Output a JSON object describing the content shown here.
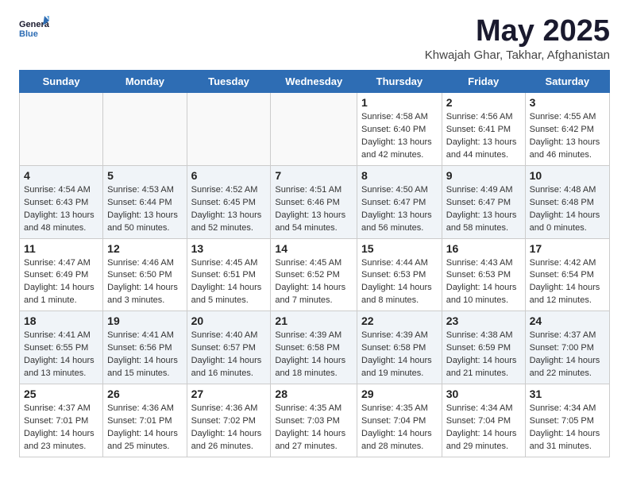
{
  "header": {
    "logo_general": "General",
    "logo_blue": "Blue",
    "month_year": "May 2025",
    "location": "Khwajah Ghar, Takhar, Afghanistan"
  },
  "days_of_week": [
    "Sunday",
    "Monday",
    "Tuesday",
    "Wednesday",
    "Thursday",
    "Friday",
    "Saturday"
  ],
  "weeks": [
    [
      {
        "day": "",
        "info": ""
      },
      {
        "day": "",
        "info": ""
      },
      {
        "day": "",
        "info": ""
      },
      {
        "day": "",
        "info": ""
      },
      {
        "day": "1",
        "info": "Sunrise: 4:58 AM\nSunset: 6:40 PM\nDaylight: 13 hours\nand 42 minutes."
      },
      {
        "day": "2",
        "info": "Sunrise: 4:56 AM\nSunset: 6:41 PM\nDaylight: 13 hours\nand 44 minutes."
      },
      {
        "day": "3",
        "info": "Sunrise: 4:55 AM\nSunset: 6:42 PM\nDaylight: 13 hours\nand 46 minutes."
      }
    ],
    [
      {
        "day": "4",
        "info": "Sunrise: 4:54 AM\nSunset: 6:43 PM\nDaylight: 13 hours\nand 48 minutes."
      },
      {
        "day": "5",
        "info": "Sunrise: 4:53 AM\nSunset: 6:44 PM\nDaylight: 13 hours\nand 50 minutes."
      },
      {
        "day": "6",
        "info": "Sunrise: 4:52 AM\nSunset: 6:45 PM\nDaylight: 13 hours\nand 52 minutes."
      },
      {
        "day": "7",
        "info": "Sunrise: 4:51 AM\nSunset: 6:46 PM\nDaylight: 13 hours\nand 54 minutes."
      },
      {
        "day": "8",
        "info": "Sunrise: 4:50 AM\nSunset: 6:47 PM\nDaylight: 13 hours\nand 56 minutes."
      },
      {
        "day": "9",
        "info": "Sunrise: 4:49 AM\nSunset: 6:47 PM\nDaylight: 13 hours\nand 58 minutes."
      },
      {
        "day": "10",
        "info": "Sunrise: 4:48 AM\nSunset: 6:48 PM\nDaylight: 14 hours\nand 0 minutes."
      }
    ],
    [
      {
        "day": "11",
        "info": "Sunrise: 4:47 AM\nSunset: 6:49 PM\nDaylight: 14 hours\nand 1 minute."
      },
      {
        "day": "12",
        "info": "Sunrise: 4:46 AM\nSunset: 6:50 PM\nDaylight: 14 hours\nand 3 minutes."
      },
      {
        "day": "13",
        "info": "Sunrise: 4:45 AM\nSunset: 6:51 PM\nDaylight: 14 hours\nand 5 minutes."
      },
      {
        "day": "14",
        "info": "Sunrise: 4:45 AM\nSunset: 6:52 PM\nDaylight: 14 hours\nand 7 minutes."
      },
      {
        "day": "15",
        "info": "Sunrise: 4:44 AM\nSunset: 6:53 PM\nDaylight: 14 hours\nand 8 minutes."
      },
      {
        "day": "16",
        "info": "Sunrise: 4:43 AM\nSunset: 6:53 PM\nDaylight: 14 hours\nand 10 minutes."
      },
      {
        "day": "17",
        "info": "Sunrise: 4:42 AM\nSunset: 6:54 PM\nDaylight: 14 hours\nand 12 minutes."
      }
    ],
    [
      {
        "day": "18",
        "info": "Sunrise: 4:41 AM\nSunset: 6:55 PM\nDaylight: 14 hours\nand 13 minutes."
      },
      {
        "day": "19",
        "info": "Sunrise: 4:41 AM\nSunset: 6:56 PM\nDaylight: 14 hours\nand 15 minutes."
      },
      {
        "day": "20",
        "info": "Sunrise: 4:40 AM\nSunset: 6:57 PM\nDaylight: 14 hours\nand 16 minutes."
      },
      {
        "day": "21",
        "info": "Sunrise: 4:39 AM\nSunset: 6:58 PM\nDaylight: 14 hours\nand 18 minutes."
      },
      {
        "day": "22",
        "info": "Sunrise: 4:39 AM\nSunset: 6:58 PM\nDaylight: 14 hours\nand 19 minutes."
      },
      {
        "day": "23",
        "info": "Sunrise: 4:38 AM\nSunset: 6:59 PM\nDaylight: 14 hours\nand 21 minutes."
      },
      {
        "day": "24",
        "info": "Sunrise: 4:37 AM\nSunset: 7:00 PM\nDaylight: 14 hours\nand 22 minutes."
      }
    ],
    [
      {
        "day": "25",
        "info": "Sunrise: 4:37 AM\nSunset: 7:01 PM\nDaylight: 14 hours\nand 23 minutes."
      },
      {
        "day": "26",
        "info": "Sunrise: 4:36 AM\nSunset: 7:01 PM\nDaylight: 14 hours\nand 25 minutes."
      },
      {
        "day": "27",
        "info": "Sunrise: 4:36 AM\nSunset: 7:02 PM\nDaylight: 14 hours\nand 26 minutes."
      },
      {
        "day": "28",
        "info": "Sunrise: 4:35 AM\nSunset: 7:03 PM\nDaylight: 14 hours\nand 27 minutes."
      },
      {
        "day": "29",
        "info": "Sunrise: 4:35 AM\nSunset: 7:04 PM\nDaylight: 14 hours\nand 28 minutes."
      },
      {
        "day": "30",
        "info": "Sunrise: 4:34 AM\nSunset: 7:04 PM\nDaylight: 14 hours\nand 29 minutes."
      },
      {
        "day": "31",
        "info": "Sunrise: 4:34 AM\nSunset: 7:05 PM\nDaylight: 14 hours\nand 31 minutes."
      }
    ]
  ]
}
